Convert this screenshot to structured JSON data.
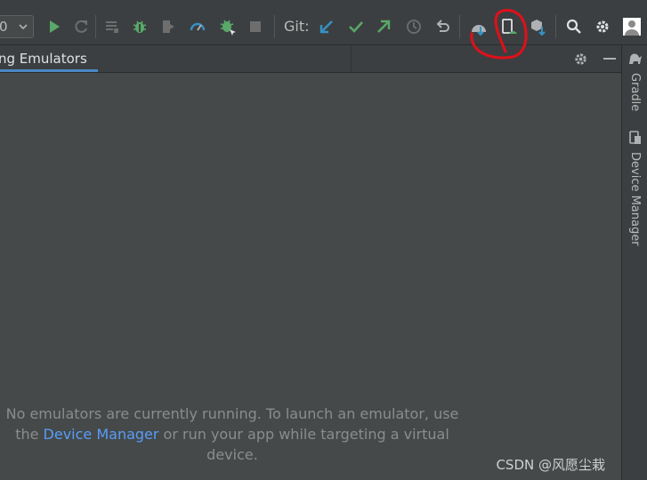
{
  "toolbar": {
    "run_config_value": "0",
    "git_label": "Git:",
    "icons": [
      "chevron-down-icon",
      "run-icon",
      "apply-changes-icon",
      "coverage-icon",
      "debug-icon",
      "attach-debugger-icon",
      "profiler-icon",
      "attach-debug-process-icon",
      "stop-icon",
      "git-update-icon",
      "git-commit-icon",
      "git-push-icon",
      "git-history-icon",
      "git-rollback-icon",
      "sdk-manager-icon",
      "device-manager-icon",
      "avd-download-icon",
      "search-icon",
      "settings-icon",
      "user-avatar-icon"
    ]
  },
  "tabs": {
    "active_label": "ng Emulators"
  },
  "panel": {
    "message_line1": "No emulators are currently running. To launch an emulator, use",
    "message_line2_prefix": "the ",
    "message_link": "Device Manager",
    "message_line2_suffix": " or run your app while targeting a virtual device."
  },
  "right_strip": {
    "gradle_label": "Gradle",
    "device_manager_label": "Device Manager"
  },
  "watermark": "CSDN @风愿尘栽",
  "colors": {
    "accent_link": "#589df6",
    "tab_underline": "#4a88c7",
    "annotation_red": "#e0101a",
    "run_green": "#59a869",
    "git_blue": "#3592c4"
  }
}
